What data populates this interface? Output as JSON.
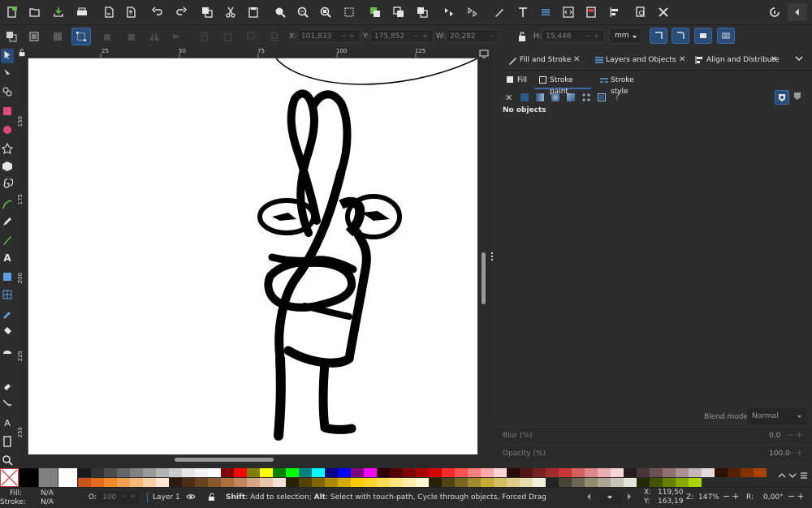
{
  "toolbar_coords": {
    "x_label": "X:",
    "x_value": "101,833",
    "y_label": "Y:",
    "y_value": "175,852",
    "w_label": "W:",
    "w_value": "20,282",
    "h_label": "H:",
    "h_value": "15,446",
    "unit": "mm"
  },
  "ruler_h": [
    "25",
    "50",
    "75",
    "100",
    "125"
  ],
  "ruler_v": [
    "150",
    "175",
    "200",
    "225",
    "250"
  ],
  "panel": {
    "tabs": [
      {
        "label": "Fill and Stroke"
      },
      {
        "label": "Layers and Objects"
      },
      {
        "label": "Align and Distribute"
      }
    ],
    "subtabs": [
      {
        "label": "Fill"
      },
      {
        "label": "Stroke paint"
      },
      {
        "label": "Stroke style"
      }
    ],
    "no_objects": "No objects",
    "blend_label": "Blend mode:",
    "blend_value": "Normal",
    "blur_label": "Blur (%)",
    "blur_value": "0,0",
    "opacity_label": "Opacity (%)",
    "opacity_value": "100,0"
  },
  "status": {
    "fill_label": "Fill:",
    "fill_value": "N/A",
    "stroke_label": "Stroke:",
    "stroke_value": "N/A",
    "opacity_label": "O:",
    "opacity_value": "100",
    "layer": "Layer 1",
    "message_bold1": "Shift",
    "message_1": ": Add to selection; ",
    "message_bold2": "Alt",
    "message_2": ": Select with touch-path, Cycle through objects, Forced Drag",
    "x_label": "X:",
    "x_value": "119,50",
    "y_label": "Y:",
    "y_value": "163,19",
    "zoom_label": "Z:",
    "zoom_value": "147%",
    "rot_label": "R:",
    "rot_value": "0,00°"
  },
  "colors": {
    "accent": "#3a6aa8",
    "panel_bg": "#2d2d2d",
    "canvas": "#ffffff"
  },
  "palette_row1": [
    "#1a1a1a",
    "#333333",
    "#4d4d4d",
    "#666666",
    "#808080",
    "#999999",
    "#b3b3b3",
    "#cccccc",
    "#e6e6e6",
    "#f2f2f2",
    "#ffffff",
    "#800000",
    "#ff0000",
    "#808000",
    "#ffff00",
    "#008000",
    "#00ff00",
    "#008080",
    "#00ffff",
    "#000080",
    "#0000ff",
    "#800080",
    "#ff00ff",
    "#2b0000",
    "#550000",
    "#800000",
    "#aa0000",
    "#d40000",
    "#ff2a2a",
    "#ff5555",
    "#ff8080",
    "#ffaaaa",
    "#ffd5d5",
    "#280b0b",
    "#501616",
    "#782121",
    "#a02c2c",
    "#c83737",
    "#d35f5f",
    "#de8787",
    "#e9afaf",
    "#f4d7d7",
    "#241c1c",
    "#483737",
    "#6c5353",
    "#916f6f",
    "#ac9393",
    "#c8b7b7",
    "#e3dbdb",
    "#2b1100",
    "#552200",
    "#803300",
    "#aa4400"
  ],
  "palette_row2": [
    "#c8541c",
    "#e06c1c",
    "#f08a28",
    "#f0a050",
    "#f4b878",
    "#f8d0a8",
    "#fce8d4",
    "#2b1a0e",
    "#4a2e18",
    "#6a4422",
    "#8a5a2e",
    "#aa7040",
    "#c08860",
    "#d6a684",
    "#e8c6ac",
    "#f4e2d6",
    "#2b2200",
    "#554400",
    "#806600",
    "#aa8800",
    "#d4aa00",
    "#ffcc00",
    "#ffd42a",
    "#ffdd55",
    "#ffe680",
    "#ffeeaa",
    "#fff6d5",
    "#28220b",
    "#504416",
    "#786721",
    "#a0892c",
    "#c8ab37",
    "#d4bc5f",
    "#dfcd87",
    "#e9ddaf",
    "#f4eed7",
    "#24221c",
    "#484537",
    "#6c6753",
    "#918a6f",
    "#aca793",
    "#c8c4b7",
    "#e3e2db",
    "#222b00",
    "#445500",
    "#668000",
    "#88aa00",
    "#aad400"
  ]
}
